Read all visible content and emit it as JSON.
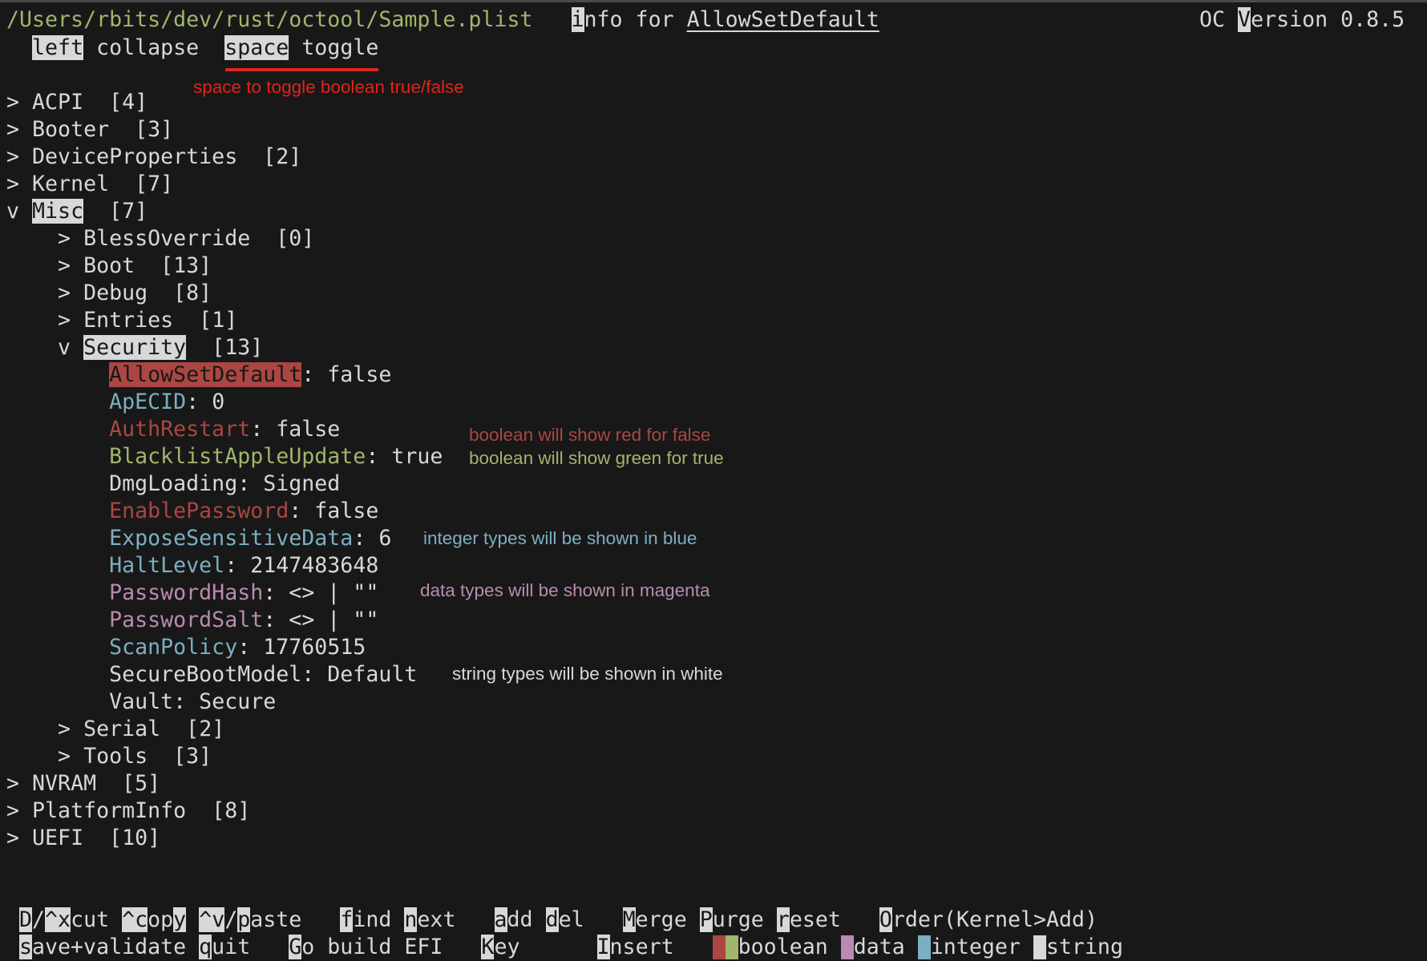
{
  "header": {
    "file_path": "/Users/rbits/dev/rust/octool/Sample.plist",
    "info_hotkey": "i",
    "info_label": "nfo for ",
    "info_target": "AllowSetDefault",
    "version_prefix": "OC ",
    "version_hotkey": "V",
    "version_label": "ersion 0.8.5"
  },
  "hints": {
    "left_key": "left",
    "left_label": " collapse",
    "space_key": "space",
    "space_label": " toggle"
  },
  "annotations": {
    "space": "space to toggle boolean true/false",
    "bool_false": "boolean will show red for false",
    "bool_true": "boolean will show green for true",
    "integer": "integer types will be shown in blue",
    "data": "data types will be shown in magenta",
    "string": "string types will be shown in white"
  },
  "colors": {
    "background": "#181818",
    "text": "#d8d8d8",
    "boolean_false": "#ab4642",
    "boolean_true": "#a1b56c",
    "integer": "#7cafc2",
    "data": "#ba8baf",
    "annotation_red": "#e0241b"
  },
  "tree": [
    {
      "name": "ACPI",
      "count": "[4]",
      "expanded": false
    },
    {
      "name": "Booter",
      "count": "[3]",
      "expanded": false
    },
    {
      "name": "DeviceProperties",
      "count": "[2]",
      "expanded": false
    },
    {
      "name": "Kernel",
      "count": "[7]",
      "expanded": false
    },
    {
      "name": "Misc",
      "count": "[7]",
      "expanded": true,
      "highlighted": true,
      "children": [
        {
          "name": "BlessOverride",
          "count": "[0]",
          "expanded": false
        },
        {
          "name": "Boot",
          "count": "[13]",
          "expanded": false
        },
        {
          "name": "Debug",
          "count": "[8]",
          "expanded": false
        },
        {
          "name": "Entries",
          "count": "[1]",
          "expanded": false
        },
        {
          "name": "Security",
          "count": "[13]",
          "expanded": true,
          "highlighted": true,
          "children": [
            {
              "key": "AllowSetDefault",
              "value": "false",
              "type": "boolean",
              "selected": true
            },
            {
              "key": "ApECID",
              "value": "0",
              "type": "integer"
            },
            {
              "key": "AuthRestart",
              "value": "false",
              "type": "boolean"
            },
            {
              "key": "BlacklistAppleUpdate",
              "value": "true",
              "type": "boolean"
            },
            {
              "key": "DmgLoading",
              "value": "Signed",
              "type": "string"
            },
            {
              "key": "EnablePassword",
              "value": "false",
              "type": "boolean"
            },
            {
              "key": "ExposeSensitiveData",
              "value": "6",
              "type": "integer"
            },
            {
              "key": "HaltLevel",
              "value": "2147483648",
              "type": "integer"
            },
            {
              "key": "PasswordHash",
              "value": "<> | \"\"",
              "type": "data"
            },
            {
              "key": "PasswordSalt",
              "value": "<> | \"\"",
              "type": "data"
            },
            {
              "key": "ScanPolicy",
              "value": "17760515",
              "type": "integer"
            },
            {
              "key": "SecureBootModel",
              "value": "Default",
              "type": "string"
            },
            {
              "key": "Vault",
              "value": "Secure",
              "type": "string"
            }
          ]
        },
        {
          "name": "Serial",
          "count": "[2]",
          "expanded": false
        },
        {
          "name": "Tools",
          "count": "[3]",
          "expanded": false
        }
      ]
    },
    {
      "name": "NVRAM",
      "count": "[5]",
      "expanded": false
    },
    {
      "name": "PlatformInfo",
      "count": "[8]",
      "expanded": false
    },
    {
      "name": "UEFI",
      "count": "[10]",
      "expanded": false
    }
  ],
  "footer": {
    "row1": [
      [
        "D",
        true
      ],
      [
        "/",
        false
      ],
      [
        "^x",
        true
      ],
      [
        "cut ",
        false
      ],
      [
        "^c",
        true
      ],
      [
        "op",
        false
      ],
      [
        "y",
        true
      ],
      [
        " ",
        false
      ],
      [
        "^v",
        true
      ],
      [
        "/",
        false
      ],
      [
        "p",
        true
      ],
      [
        "aste   ",
        false
      ],
      [
        "f",
        true
      ],
      [
        "ind ",
        false
      ],
      [
        "n",
        true
      ],
      [
        "ext   ",
        false
      ],
      [
        "a",
        true
      ],
      [
        "dd ",
        false
      ],
      [
        "d",
        true
      ],
      [
        "el   ",
        false
      ],
      [
        "M",
        true
      ],
      [
        "erge ",
        false
      ],
      [
        "P",
        true
      ],
      [
        "urge ",
        false
      ],
      [
        "r",
        true
      ],
      [
        "eset   ",
        false
      ],
      [
        "O",
        true
      ],
      [
        "rder(Kernel>Add)",
        false
      ]
    ],
    "row2": [
      [
        "s",
        true
      ],
      [
        "ave+validate ",
        false
      ],
      [
        "q",
        true
      ],
      [
        "uit   ",
        false
      ],
      [
        "G",
        true
      ],
      [
        "o build EFI   ",
        false
      ],
      [
        "K",
        true
      ],
      [
        "ey      ",
        false
      ],
      [
        "I",
        true
      ],
      [
        "nsert   ",
        false
      ]
    ],
    "legend": {
      "boolean": "boolean",
      "data": "data",
      "integer": "integer",
      "string": "string"
    }
  }
}
